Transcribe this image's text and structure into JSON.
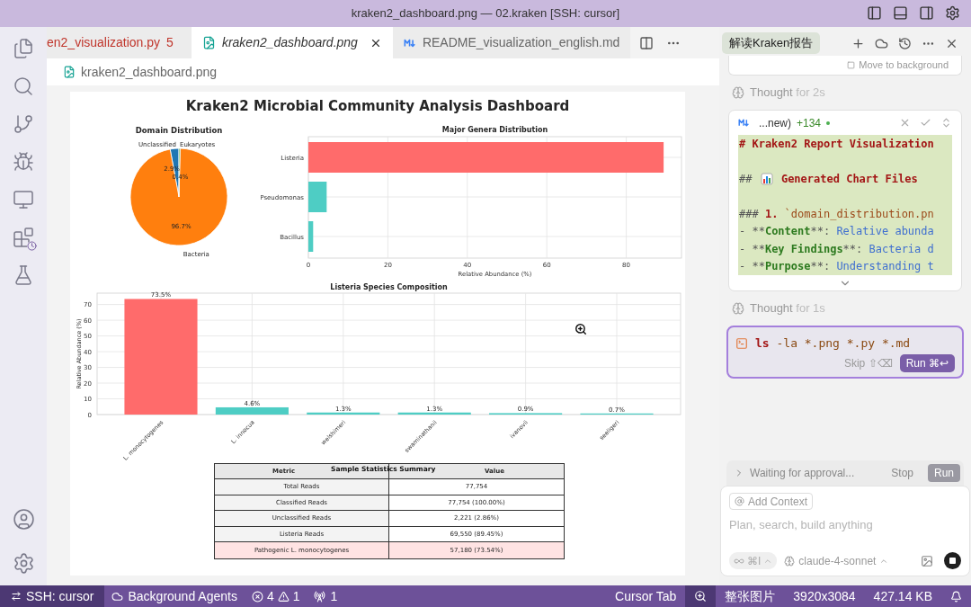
{
  "window": {
    "title": "kraken2_dashboard.png — 02.kraken [SSH: cursor]"
  },
  "editor": {
    "tabs": [
      {
        "label": "en2_visualization.py",
        "kind": "python",
        "selected": false,
        "problems": "5"
      },
      {
        "label": "kraken2_dashboard.png",
        "kind": "image",
        "selected": true
      },
      {
        "label": "README_visualization_english.md",
        "kind": "markdown",
        "selected": false
      }
    ],
    "breadcrumb": "kraken2_dashboard.png"
  },
  "dashboard": {
    "title": "Kraken2 Microbial Community Analysis Dashboard",
    "domain_chart": {
      "chart_data": {
        "type": "pie",
        "title": "Domain Distribution",
        "categories": [
          "Unclassified",
          "Bacteria",
          "Eukaryotes"
        ],
        "values": [
          2.9,
          96.7,
          0.4
        ],
        "value_labels": [
          "2.9%",
          "96.7%",
          "0.4%"
        ]
      }
    },
    "genera_chart": {
      "chart_data": {
        "type": "bar",
        "orientation": "horizontal",
        "title": "Major Genera Distribution",
        "categories": [
          "Listeria",
          "Pseudomonas",
          "Bacillus"
        ],
        "series": [
          {
            "color": "#ff6b6b",
            "values": [
              89.4,
              null,
              null
            ]
          },
          {
            "color": "#4ecdc4",
            "values": [
              null,
              4.6,
              1.2
            ]
          }
        ],
        "stacked": true,
        "grid": true,
        "xlabel": "Relative Abundance (%)",
        "xlim": [
          0,
          93.9
        ],
        "xticks": [
          0,
          20,
          40,
          60,
          80
        ]
      }
    },
    "species_chart": {
      "chart_data": {
        "type": "bar",
        "title": "Listeria Species Composition",
        "ylabel": "Relative Abundance (%)",
        "categories": [
          "L. monocytogenes",
          "L. innocua",
          "welshimeri",
          "swaminathanii",
          "ivanovii",
          "seeligeri"
        ],
        "series": [
          {
            "color": "#ff6b6b",
            "values": [
              73.5,
              null,
              null,
              null,
              null,
              null
            ]
          },
          {
            "color": "#4ecdc4",
            "values": [
              null,
              4.6,
              1.3,
              1.3,
              0.9,
              0.7
            ]
          }
        ],
        "stacked": true,
        "grid": true,
        "ylim": [
          0,
          77.2
        ],
        "yticks": [
          0,
          10,
          20,
          30,
          40,
          50,
          60,
          70
        ],
        "value_labels": [
          "73.5%",
          "4.6%",
          "1.3%",
          "1.3%",
          "0.9%",
          "0.7%"
        ]
      }
    },
    "stats_table": {
      "title": "Sample Statistics Summary",
      "columns": [
        "Metric",
        "Value"
      ],
      "rows": [
        {
          "cells": [
            "Total Reads",
            "77,754"
          ],
          "highlighted": false
        },
        {
          "cells": [
            "Classified Reads",
            "77,754 (100.00%)"
          ],
          "highlighted": false
        },
        {
          "cells": [
            "Unclassified Reads",
            "2,221 (2.86%)"
          ],
          "highlighted": false
        },
        {
          "cells": [
            "Listeria Reads",
            "69,550 (89.45%)"
          ],
          "highlighted": false
        },
        {
          "cells": [
            "Pathogenic L. monocytogenes",
            "57,180 (73.54%)"
          ],
          "highlighted": true
        }
      ]
    }
  },
  "agent_panel": {
    "title": "解读Kraken报告",
    "background_action": "Move to background",
    "thoughts": [
      {
        "label": "Thought",
        "duration": "for 2s"
      },
      {
        "label": "Thought",
        "duration": "for 1s"
      }
    ],
    "diff": {
      "file": "...new)",
      "additions": "+134",
      "lines": [
        {
          "kind": "line",
          "segments": [
            {
              "kind": "heading",
              "text": "# Kraken2 Report Visualization"
            }
          ]
        },
        {
          "kind": "blank"
        },
        {
          "kind": "line",
          "segments": [
            {
              "kind": "mark",
              "text": "## "
            },
            {
              "kind": "emoji"
            },
            {
              "kind": "heading",
              "text": " Generated Chart Files"
            }
          ]
        },
        {
          "kind": "blank"
        },
        {
          "kind": "line",
          "segments": [
            {
              "kind": "mark",
              "text": "### "
            },
            {
              "kind": "heading",
              "text": "1."
            },
            {
              "kind": "code",
              "text": " `domain_distribution.pn"
            }
          ]
        },
        {
          "kind": "line",
          "segments": [
            {
              "kind": "mark",
              "text": "- **"
            },
            {
              "kind": "bold",
              "text": "Content"
            },
            {
              "kind": "mark",
              "text": "**: "
            },
            {
              "kind": "text",
              "text": "Relative abunda"
            }
          ]
        },
        {
          "kind": "line",
          "segments": [
            {
              "kind": "mark",
              "text": "- **"
            },
            {
              "kind": "bold",
              "text": "Key Findings"
            },
            {
              "kind": "mark",
              "text": "**: "
            },
            {
              "kind": "text",
              "text": "Bacteria d"
            }
          ]
        },
        {
          "kind": "line",
          "segments": [
            {
              "kind": "mark",
              "text": "- **"
            },
            {
              "kind": "bold",
              "text": "Purpose"
            },
            {
              "kind": "mark",
              "text": "**: "
            },
            {
              "kind": "text",
              "text": "Understanding t"
            }
          ]
        }
      ]
    },
    "command": {
      "program": "ls",
      "args": "-la *.png *.py *.md",
      "skip": "Skip ⇧⌫",
      "run": "Run ⌘↩"
    },
    "approval": {
      "status": "Waiting for approval...",
      "stop": "Stop",
      "run": "Run"
    },
    "composer": {
      "context": "Add Context",
      "placeholder": "Plan, search, build anything",
      "mode": "⌘I",
      "model": "claude-4-sonnet"
    }
  },
  "status_bar": {
    "left": [
      {
        "kind": "remote",
        "text": "SSH: cursor"
      },
      {
        "kind": "agents",
        "text": "Background Agents"
      },
      {
        "kind": "problems",
        "errors": "4",
        "warnings": "1"
      },
      {
        "kind": "ports",
        "text": "1"
      }
    ],
    "right": [
      {
        "kind": "plain",
        "text": "Cursor Tab"
      },
      {
        "kind": "zoom"
      },
      {
        "kind": "plain",
        "text": "整张图片"
      },
      {
        "kind": "plain",
        "text": "3920x3084"
      },
      {
        "kind": "plain",
        "text": "427.14 KB"
      },
      {
        "kind": "bell"
      }
    ]
  }
}
